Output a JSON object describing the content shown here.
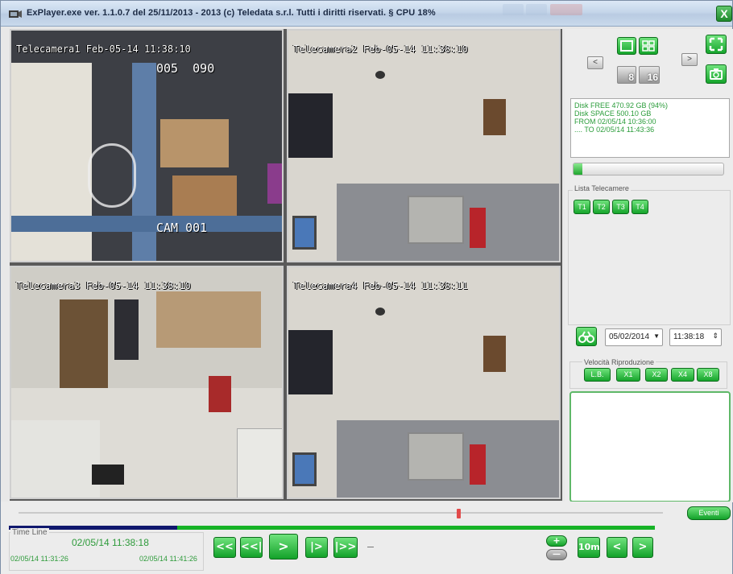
{
  "window": {
    "title": "ExPlayer.exe ver. 1.1.0.7 del 25/11/2013 - 2013 (c) Teledata s.r.l. Tutti i diritti riservati. § CPU 18%",
    "close_label": "X"
  },
  "cameras": [
    {
      "label": "Telecamera1 Feb-05-14 11:38:10",
      "osd_top": "005  090",
      "osd_bottom": "CAM 001"
    },
    {
      "label": "Telecamera2 Feb-05-14 11:38:10"
    },
    {
      "label": "Telecamera3 Feb-05-14 11:38:10"
    },
    {
      "label": "Telecamera4 Feb-05-14 11:38:11"
    }
  ],
  "layout_controls": {
    "prev": "<",
    "next": ">",
    "layout8": "8",
    "layout16": "16"
  },
  "disk": {
    "free": "Disk FREE   470.92 GB (94%)",
    "space": "Disk SPACE 500.10 GB",
    "from": "FROM 02/05/14 10:36:00",
    "to": ".... TO 02/05/14 11:43:36",
    "usage_fraction": 0.06
  },
  "camera_list": {
    "title": "Lista Telecamere",
    "items": [
      "T1",
      "T2",
      "T3",
      "T4"
    ]
  },
  "search": {
    "date": "05/02/2014",
    "time": "11:38:18"
  },
  "speed": {
    "title": "Velocità Riproduzione",
    "options": [
      "L.B.",
      "X1",
      "X2",
      "X4",
      "X8"
    ]
  },
  "timeline": {
    "title": "Time Line",
    "current": "02/05/14 11:38:18",
    "start": "02/05/14 11:31:26",
    "end": "02/05/14 11:41:26",
    "progress_fraction": 0.26,
    "seek_fraction": 0.7
  },
  "playback": {
    "rewind": "<<",
    "step_back": "<<|",
    "play": ">",
    "step_forward": "|>",
    "forward": "|>>",
    "zoom_plus": "+",
    "zoom_minus": "—",
    "interval": "10m",
    "prev": "<",
    "next": ">"
  },
  "events_button": "Eventi",
  "colors": {
    "accent_green": "#16a52c",
    "progress_done": "#10186e",
    "seek_thumb": "#e24a4a",
    "info_text": "#2a9c3a"
  }
}
